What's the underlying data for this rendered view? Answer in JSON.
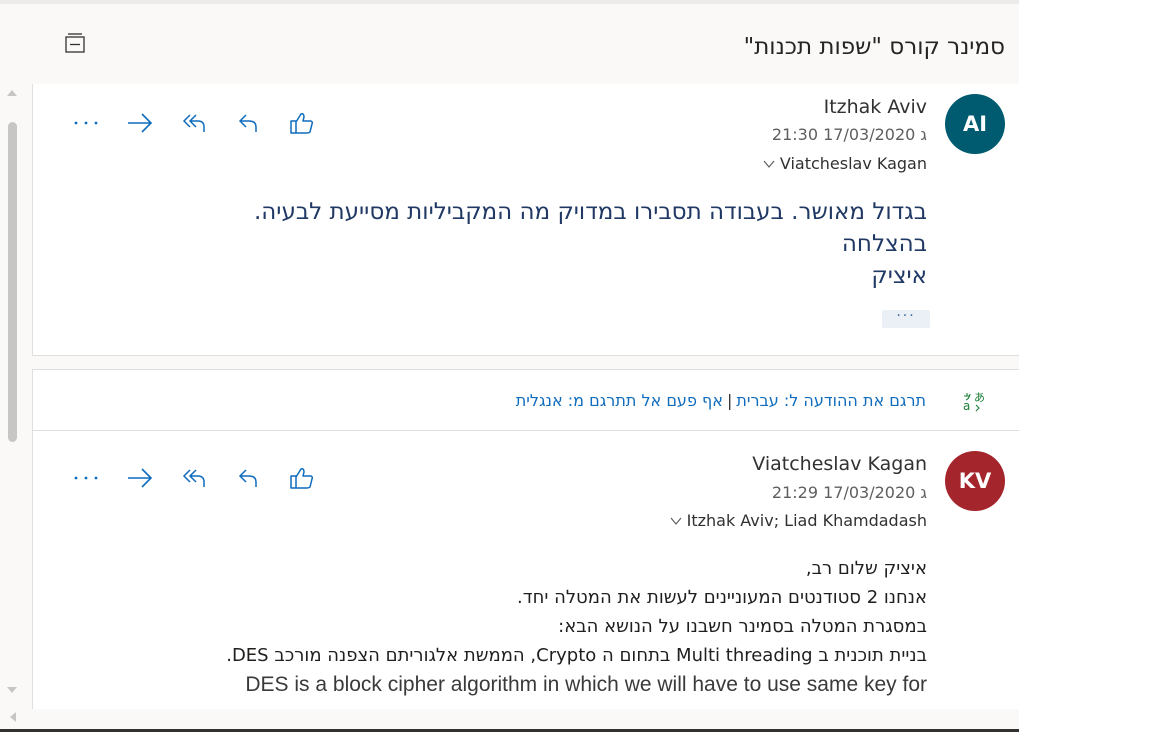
{
  "thread": {
    "subject": "סמינר קורס \"שפות תכנות\"",
    "collapse_icon": "collapse-all-icon"
  },
  "message1": {
    "avatar_initials": "AI",
    "avatar_color": "#005b70",
    "sender": "Itzhak Aviv",
    "date": "ג 17/03/2020 21:30",
    "recipients": "Viatcheslav Kagan",
    "body_lines": [
      "בגדול מאושר. בעבודה תסבירו במדויק מה המקביליות מסייעת לבעיה.",
      "בהצלחה",
      "איציק"
    ],
    "expand_label": "···",
    "actions": [
      "like-icon",
      "reply-icon",
      "reply-all-icon",
      "forward-icon",
      "more-icon"
    ]
  },
  "translation_bar": {
    "translate_link": "תרגם את ההודעה ל: עברית",
    "separator": "|",
    "never_link": "אף פעם אל תתרגם מ: אנגלית",
    "icon": "translate-icon"
  },
  "message2": {
    "avatar_initials": "KV",
    "avatar_color": "#a4262c",
    "sender": "Viatcheslav Kagan",
    "date": "ג 17/03/2020 21:29",
    "recipients": "Itzhak Aviv; Liad Khamdadash",
    "body_lines": [
      "איציק שלום רב,",
      "אנחנו 2 סטודנטים המעוניינים לעשות את המטלה יחד.",
      "במסגרת המטלה בסמינר חשבנו על הנושא הבא:",
      "בניית תוכנית ב Multi threading בתחום ה Crypto, הממשת אלגוריתם הצפנה מורכב DES."
    ],
    "body_english": "DES is a block cipher algorithm in which we will have to use same key for",
    "actions": [
      "like-icon",
      "reply-icon",
      "reply-all-icon",
      "forward-icon",
      "more-icon"
    ]
  },
  "colors": {
    "link": "#0f6cbd",
    "body_text_blue": "#1f3864",
    "background": "#faf9f8"
  }
}
